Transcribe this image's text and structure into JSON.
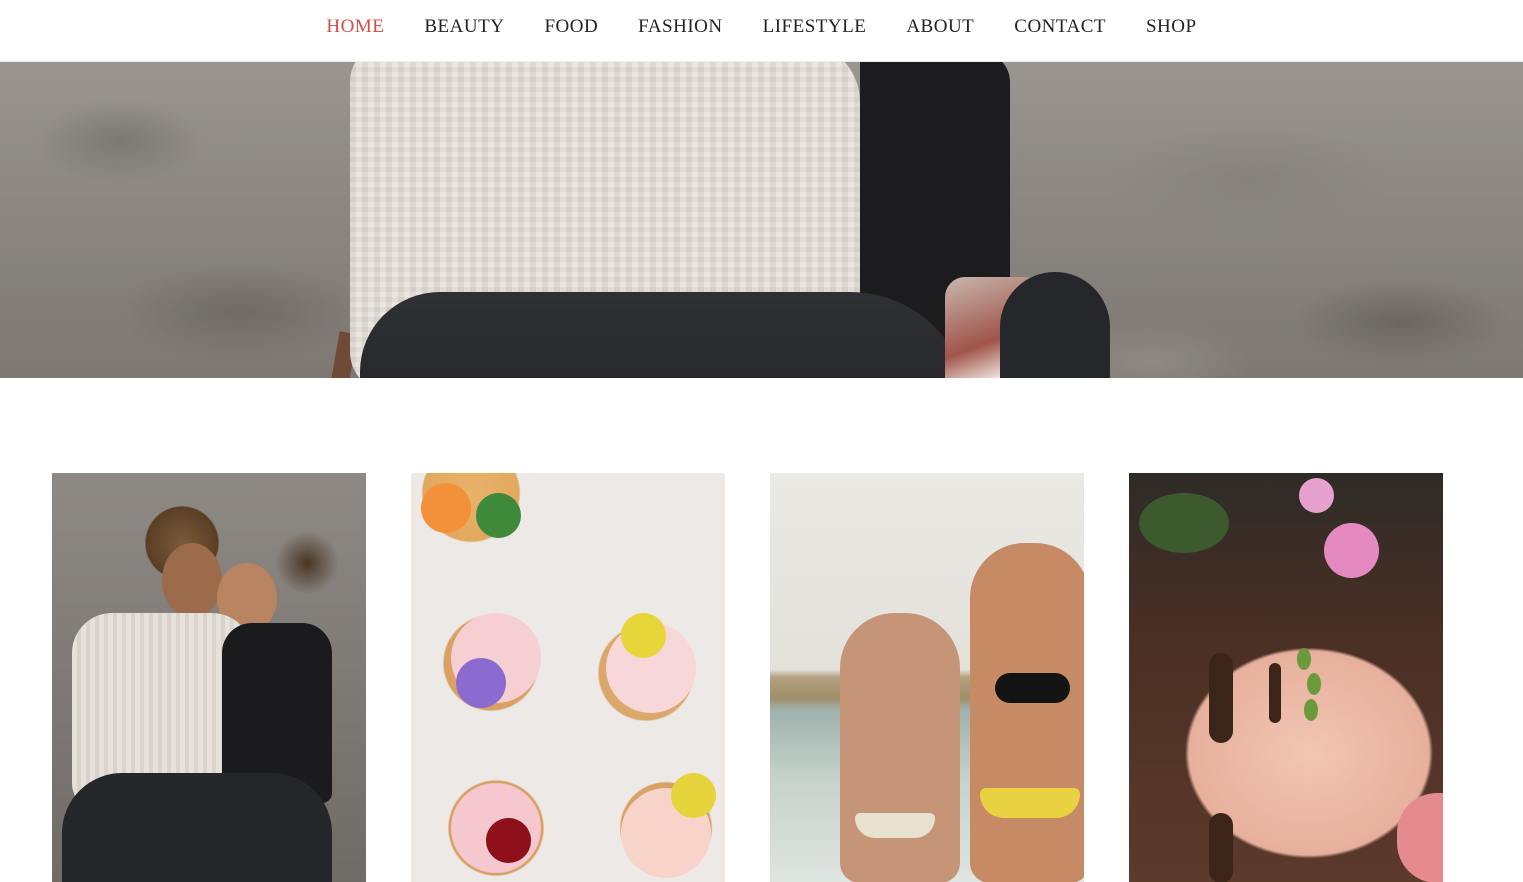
{
  "nav": {
    "items": [
      {
        "label": "HOME",
        "active": true
      },
      {
        "label": "BEAUTY",
        "active": false
      },
      {
        "label": "FOOD",
        "active": false
      },
      {
        "label": "FASHION",
        "active": false
      },
      {
        "label": "LIFESTYLE",
        "active": false
      },
      {
        "label": "ABOUT",
        "active": false
      },
      {
        "label": "CONTACT",
        "active": false
      },
      {
        "label": "SHOP",
        "active": false
      }
    ]
  },
  "colors": {
    "active_nav": "#d84a4a",
    "nav_text": "#222222",
    "background": "#ffffff"
  }
}
